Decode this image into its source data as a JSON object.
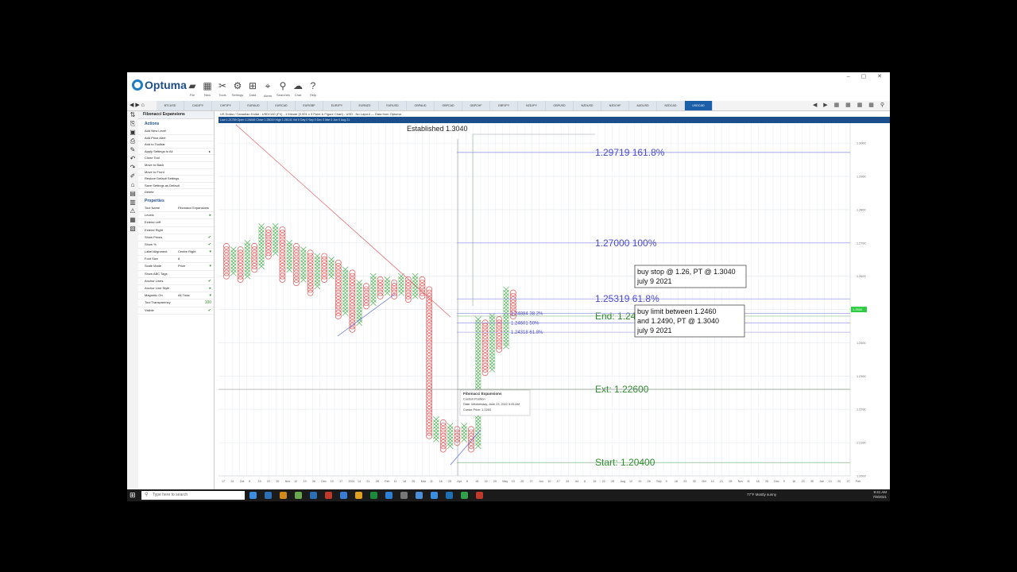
{
  "app": {
    "logo_text": "Optuma",
    "window_controls": "– ▢ ✕"
  },
  "ribbon": [
    {
      "label": "File",
      "icon": "folder-icon",
      "glyph": "▰"
    },
    {
      "label": "New",
      "icon": "new-chart-icon",
      "glyph": "▦"
    },
    {
      "label": "Tools",
      "icon": "tools-icon",
      "glyph": "✂"
    },
    {
      "label": "Settings",
      "icon": "settings-icon",
      "glyph": "⚙"
    },
    {
      "label": "Data",
      "icon": "data-icon",
      "glyph": "⊞"
    },
    {
      "label": "Alerts",
      "icon": "alerts-icon",
      "glyph": "⌖"
    },
    {
      "label": "Searches",
      "icon": "search-icon",
      "glyph": "⚲"
    },
    {
      "label": "Chat",
      "icon": "chat-icon",
      "glyph": "☁"
    },
    {
      "label": "Help",
      "icon": "help-icon",
      "glyph": "?"
    }
  ],
  "tabs": {
    "nav": "◀ ▶ ⌂",
    "items": [
      "BTCUSD",
      "CADJPY",
      "CHFJPY",
      "EURAUD",
      "EURCAD",
      "EURGBP",
      "EURJPY",
      "EURNZD",
      "EURUSD",
      "GBPAUD",
      "GBPCAD",
      "GBPCHF",
      "GBPJPY",
      "NZDJPY",
      "GBPUSD",
      "NZDUSD",
      "NZDCHF",
      "AUDUSD",
      "NZDCAD",
      "USDCAD"
    ],
    "active_index": 19,
    "right_controls": "◀ ▶ ▦ ▦ ▦ ▦ ⚲"
  },
  "left_icons": [
    "⇅",
    "⎘",
    "▣",
    "⎙",
    "✎",
    "↶",
    "↷",
    "✐",
    "⌂",
    "▤",
    "▥",
    "⚠",
    "▦",
    "▧"
  ],
  "panel": {
    "title": "Fibonacci Expansions",
    "actions_label": "Actions",
    "actions": [
      {
        "label": "Add New Level",
        "arrow": ""
      },
      {
        "label": "Add Price Alert",
        "arrow": ""
      },
      {
        "label": "Add to Toolbar",
        "arrow": ""
      },
      {
        "label": "Apply Settings to All",
        "arrow": "▸"
      },
      {
        "label": "Clone Tool",
        "arrow": ""
      },
      {
        "label": "Move to Back",
        "arrow": ""
      },
      {
        "label": "Move to Front",
        "arrow": ""
      },
      {
        "label": "Restore Default Settings",
        "arrow": ""
      },
      {
        "label": "Save Settings as Default",
        "arrow": ""
      },
      {
        "label": "Delete",
        "arrow": ""
      }
    ],
    "properties_label": "Properties",
    "properties": [
      {
        "label": "Tool Name",
        "value": "Fibonacci Expansions",
        "check": ""
      },
      {
        "label": "Levels",
        "value": "",
        "check": "▸"
      },
      {
        "label": "Extend Left",
        "value": "",
        "check": ""
      },
      {
        "label": "Extend Right",
        "value": "",
        "check": ""
      },
      {
        "label": "Show Prices",
        "value": "",
        "check": "✔"
      },
      {
        "label": "Show %",
        "value": "",
        "check": "✔"
      },
      {
        "label": "Label Alignment",
        "value": "Centre Right",
        "check": "▾"
      },
      {
        "label": "Font Size",
        "value": "8",
        "check": ""
      },
      {
        "label": "Scale Mode",
        "value": "Price",
        "check": "▾"
      },
      {
        "label": "Show ABC Tags",
        "value": "",
        "check": ""
      },
      {
        "label": "Anchor Lines",
        "value": "",
        "check": "✔"
      },
      {
        "label": "Anchor Line Style",
        "value": "",
        "check": "▸"
      },
      {
        "label": "Magnetic On",
        "value": "All Ticks",
        "check": "▾"
      },
      {
        "label": "Tool Transparency",
        "value": "",
        "check": "100"
      },
      {
        "label": "Visible",
        "value": "",
        "check": "✔"
      }
    ]
  },
  "chart_header": {
    "line1": "US Dollar / Canadian Dollar - USDCAD (FX) - 1 Minute (0.001 x 3 Point & Figure Chart) - USD - No Layout — Data from Optuma",
    "line2": "Low 1.21789 Open 1.24848 Close 1.25019 High 1.26141 Vol 0 Day 0 Sep 0 Dec 0 Mar 0 Jun 0 Aug 21"
  },
  "chart_data": {
    "type": "point-and-figure",
    "annotations": {
      "established": "Established 1.3040",
      "fib_labels": [
        {
          "text": "1.29719   161.8%",
          "price": 1.29719
        },
        {
          "text": "1.27000   100%",
          "price": 1.27
        },
        {
          "text": "1.25319   61.8%",
          "price": 1.25319
        },
        {
          "text": "End: 1.24800",
          "price": 1.248
        },
        {
          "text": "Ext: 1.22600",
          "price": 1.226
        },
        {
          "text": "Start: 1.20400",
          "price": 1.204
        }
      ],
      "retrace_labels": [
        {
          "text": "1.24884   38.2%",
          "price": 1.24884
        },
        {
          "text": "1.24601   50%",
          "price": 1.24601
        },
        {
          "text": "1.24318   61.8%",
          "price": 1.24318
        }
      ],
      "note1": [
        "buy stop @ 1.26, PT @ 1.3040",
        "july 9 2021"
      ],
      "note2": [
        "buy limit between 1.2460",
        "and 1.2490, PT @ 1.3040",
        "july 9 2021"
      ],
      "tooltip": [
        "Fibonacci Expansions",
        "Custom Position",
        "Date: Wednesday, June 23, 2021 9:05 AM",
        "Cursor Price: 1.2260"
      ],
      "price_tag": "1.2500"
    },
    "y_ticks": [
      "1.3000",
      "1.2900",
      "1.2800",
      "1.2700",
      "1.2600",
      "1.2500",
      "1.2400",
      "1.2300",
      "1.2200",
      "1.2100",
      "1.2000"
    ],
    "x_ticks": [
      "17",
      "24",
      "Oct",
      "8",
      "15",
      "22",
      "29",
      "Nov",
      "12",
      "19",
      "26",
      "Dec",
      "10",
      "17",
      "2021",
      "14",
      "21",
      "28",
      "Feb",
      "11",
      "18",
      "25",
      "Mar",
      "11",
      "18",
      "25",
      "Apr",
      "8",
      "15",
      "22",
      "29",
      "May",
      "13",
      "20",
      "27",
      "Jun",
      "10",
      "17",
      "24",
      "Jul",
      "8",
      "15",
      "22",
      "29",
      "Aug",
      "12",
      "19",
      "26",
      "Sep",
      "9",
      "16",
      "23",
      "30",
      "Oct",
      "14",
      "21",
      "28",
      "Nov",
      "11",
      "18",
      "25",
      "Dec",
      "9",
      "16",
      "23",
      "30",
      "Jan",
      "13",
      "20",
      "27",
      "Feb"
    ],
    "columns": [
      {
        "t": "O",
        "hi": 1.269,
        "lo": 1.26
      },
      {
        "t": "X",
        "hi": 1.268,
        "lo": 1.261
      },
      {
        "t": "O",
        "hi": 1.268,
        "lo": 1.259
      },
      {
        "t": "X",
        "hi": 1.27,
        "lo": 1.26
      },
      {
        "t": "O",
        "hi": 1.269,
        "lo": 1.262
      },
      {
        "t": "X",
        "hi": 1.275,
        "lo": 1.263
      },
      {
        "t": "O",
        "hi": 1.274,
        "lo": 1.266
      },
      {
        "t": "X",
        "hi": 1.275,
        "lo": 1.267
      },
      {
        "t": "O",
        "hi": 1.274,
        "lo": 1.259
      },
      {
        "t": "X",
        "hi": 1.27,
        "lo": 1.262
      },
      {
        "t": "O",
        "hi": 1.269,
        "lo": 1.258
      },
      {
        "t": "X",
        "hi": 1.268,
        "lo": 1.259
      },
      {
        "t": "O",
        "hi": 1.267,
        "lo": 1.255
      },
      {
        "t": "X",
        "hi": 1.266,
        "lo": 1.257
      },
      {
        "t": "O",
        "hi": 1.266,
        "lo": 1.259
      },
      {
        "t": "X",
        "hi": 1.265,
        "lo": 1.26
      },
      {
        "t": "O",
        "hi": 1.264,
        "lo": 1.248
      },
      {
        "t": "X",
        "hi": 1.262,
        "lo": 1.249
      },
      {
        "t": "O",
        "hi": 1.261,
        "lo": 1.244
      },
      {
        "t": "X",
        "hi": 1.258,
        "lo": 1.246
      },
      {
        "t": "O",
        "hi": 1.257,
        "lo": 1.251
      },
      {
        "t": "X",
        "hi": 1.26,
        "lo": 1.252
      },
      {
        "t": "O",
        "hi": 1.259,
        "lo": 1.254
      },
      {
        "t": "X",
        "hi": 1.259,
        "lo": 1.255
      },
      {
        "t": "O",
        "hi": 1.258,
        "lo": 1.254
      },
      {
        "t": "X",
        "hi": 1.26,
        "lo": 1.255
      },
      {
        "t": "O",
        "hi": 1.259,
        "lo": 1.253
      },
      {
        "t": "X",
        "hi": 1.26,
        "lo": 1.254
      },
      {
        "t": "O",
        "hi": 1.259,
        "lo": 1.254
      },
      {
        "t": "O",
        "hi": 1.256,
        "lo": 1.212
      },
      {
        "t": "X",
        "hi": 1.217,
        "lo": 1.211
      },
      {
        "t": "O",
        "hi": 1.216,
        "lo": 1.208
      },
      {
        "t": "X",
        "hi": 1.215,
        "lo": 1.209
      },
      {
        "t": "O",
        "hi": 1.214,
        "lo": 1.21
      },
      {
        "t": "X",
        "hi": 1.215,
        "lo": 1.211
      },
      {
        "t": "O",
        "hi": 1.214,
        "lo": 1.208
      },
      {
        "t": "X",
        "hi": 1.247,
        "lo": 1.209
      },
      {
        "t": "O",
        "hi": 1.246,
        "lo": 1.231
      },
      {
        "t": "X",
        "hi": 1.248,
        "lo": 1.232
      },
      {
        "t": "O",
        "hi": 1.247,
        "lo": 1.238
      },
      {
        "t": "X",
        "hi": 1.256,
        "lo": 1.239
      },
      {
        "t": "O",
        "hi": 1.255,
        "lo": 1.248
      }
    ]
  },
  "taskbar": {
    "search_placeholder": "Type here to search",
    "weather": "77°F  Mostly sunny",
    "time": "9:41 AM",
    "date": "7/9/2021",
    "apps": [
      "#3b8de0",
      "#2d6fb5",
      "#d08b1a",
      "#6aa84f",
      "#2d6fb5",
      "#c0392b",
      "#3a7bd5",
      "#e0a020",
      "#1b8a3a",
      "#2c7fd4",
      "#777777",
      "#4a90d9",
      "#3b8de0",
      "#1f6fb5",
      "#30a04a",
      "#c0392b"
    ]
  }
}
